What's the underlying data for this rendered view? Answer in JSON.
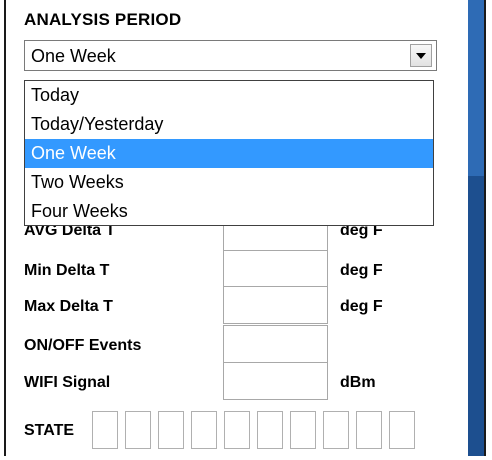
{
  "analysis_period": {
    "heading": "ANALYSIS PERIOD",
    "selected_value": "One Week",
    "options": [
      "Today",
      "Today/Yesterday",
      "One Week",
      "Two Weeks",
      "Four Weeks"
    ],
    "selected_index": 2
  },
  "metrics": [
    {
      "label": "AVG Delta T",
      "unit": "deg F",
      "value": ""
    },
    {
      "label": "Min Delta T",
      "unit": "deg F",
      "value": ""
    },
    {
      "label": "Max Delta T",
      "unit": "deg F",
      "value": ""
    },
    {
      "label": "ON/OFF Events",
      "unit": "",
      "value": ""
    },
    {
      "label": "WIFI Signal",
      "unit": "dBm",
      "value": ""
    }
  ],
  "state": {
    "label": "STATE",
    "box_count": 10
  },
  "colors": {
    "selection": "#3399ff",
    "scrollbar": "#1d4f8f"
  }
}
